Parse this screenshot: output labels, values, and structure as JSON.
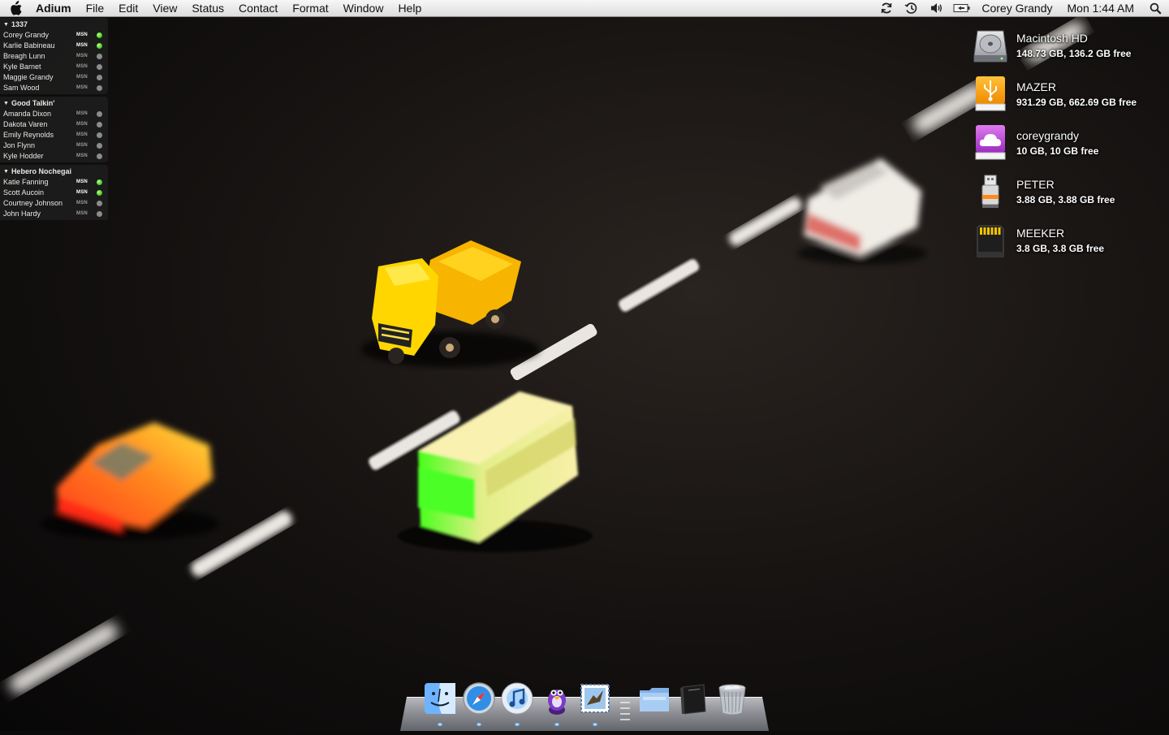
{
  "menubar": {
    "app_name": "Adium",
    "menus": [
      "File",
      "Edit",
      "View",
      "Status",
      "Contact",
      "Format",
      "Window",
      "Help"
    ],
    "status_icons": [
      "sync-icon",
      "time-machine-icon",
      "volume-icon",
      "battery-icon"
    ],
    "user_name": "Corey Grandy",
    "clock": "Mon 1:44 AM"
  },
  "contact_list": {
    "groups": [
      {
        "name": "1337",
        "contacts": [
          {
            "name": "Corey Grandy",
            "service": "MSN",
            "online": true
          },
          {
            "name": "Karlie Babineau",
            "service": "MSN",
            "online": true
          },
          {
            "name": "Breagh Lunn",
            "service": "MSN",
            "online": false
          },
          {
            "name": "Kyle Barnet",
            "service": "MSN",
            "online": false
          },
          {
            "name": "Maggie Grandy",
            "service": "MSN",
            "online": false
          },
          {
            "name": "Sam Wood",
            "service": "MSN",
            "online": false
          }
        ]
      },
      {
        "name": "Good Talkin'",
        "contacts": [
          {
            "name": "Amanda Dixon",
            "service": "MSN",
            "online": false
          },
          {
            "name": "Dakota Varen",
            "service": "MSN",
            "online": false
          },
          {
            "name": "Emily Reynolds",
            "service": "MSN",
            "online": false
          },
          {
            "name": "Jon Flynn",
            "service": "MSN",
            "online": false
          },
          {
            "name": "Kyle Hodder",
            "service": "MSN",
            "online": false
          }
        ]
      },
      {
        "name": "Hebero Nochegai",
        "contacts": [
          {
            "name": "Katie Fanning",
            "service": "MSN",
            "online": true
          },
          {
            "name": "Scott Aucoin",
            "service": "MSN",
            "online": true
          },
          {
            "name": "Courtney Johnson",
            "service": "MSN",
            "online": false
          },
          {
            "name": "John Hardy",
            "service": "MSN",
            "online": false
          }
        ]
      }
    ]
  },
  "volumes": [
    {
      "name": "Macintosh HD",
      "info": "148.73 GB, 136.2 GB free",
      "icon": "hard-drive-icon"
    },
    {
      "name": "MAZER",
      "info": "931.29 GB, 662.69 GB free",
      "icon": "usb-drive-icon"
    },
    {
      "name": "coreygrandy",
      "info": "10 GB, 10 GB free",
      "icon": "idisk-icon"
    },
    {
      "name": "PETER",
      "info": "3.88 GB, 3.88 GB free",
      "icon": "flash-drive-icon"
    },
    {
      "name": "MEEKER",
      "info": "3.8 GB, 3.8 GB free",
      "icon": "sd-card-icon"
    }
  ],
  "dock": {
    "items": [
      {
        "icon": "finder-icon",
        "running": true
      },
      {
        "icon": "safari-icon",
        "running": true
      },
      {
        "icon": "itunes-icon",
        "running": true
      },
      {
        "icon": "adium-icon",
        "running": true
      },
      {
        "icon": "mail-icon",
        "running": true
      },
      {
        "icon": "folder-stack-icon",
        "running": false
      },
      {
        "icon": "notebook-icon",
        "running": false
      },
      {
        "icon": "trash-icon",
        "running": false
      }
    ]
  },
  "colors": {
    "menubar_bg": "#e8e8e8",
    "online_green": "#3cc21b",
    "offline_gray": "#8c8c8c",
    "contact_list_bg": "#1c1c1c"
  }
}
